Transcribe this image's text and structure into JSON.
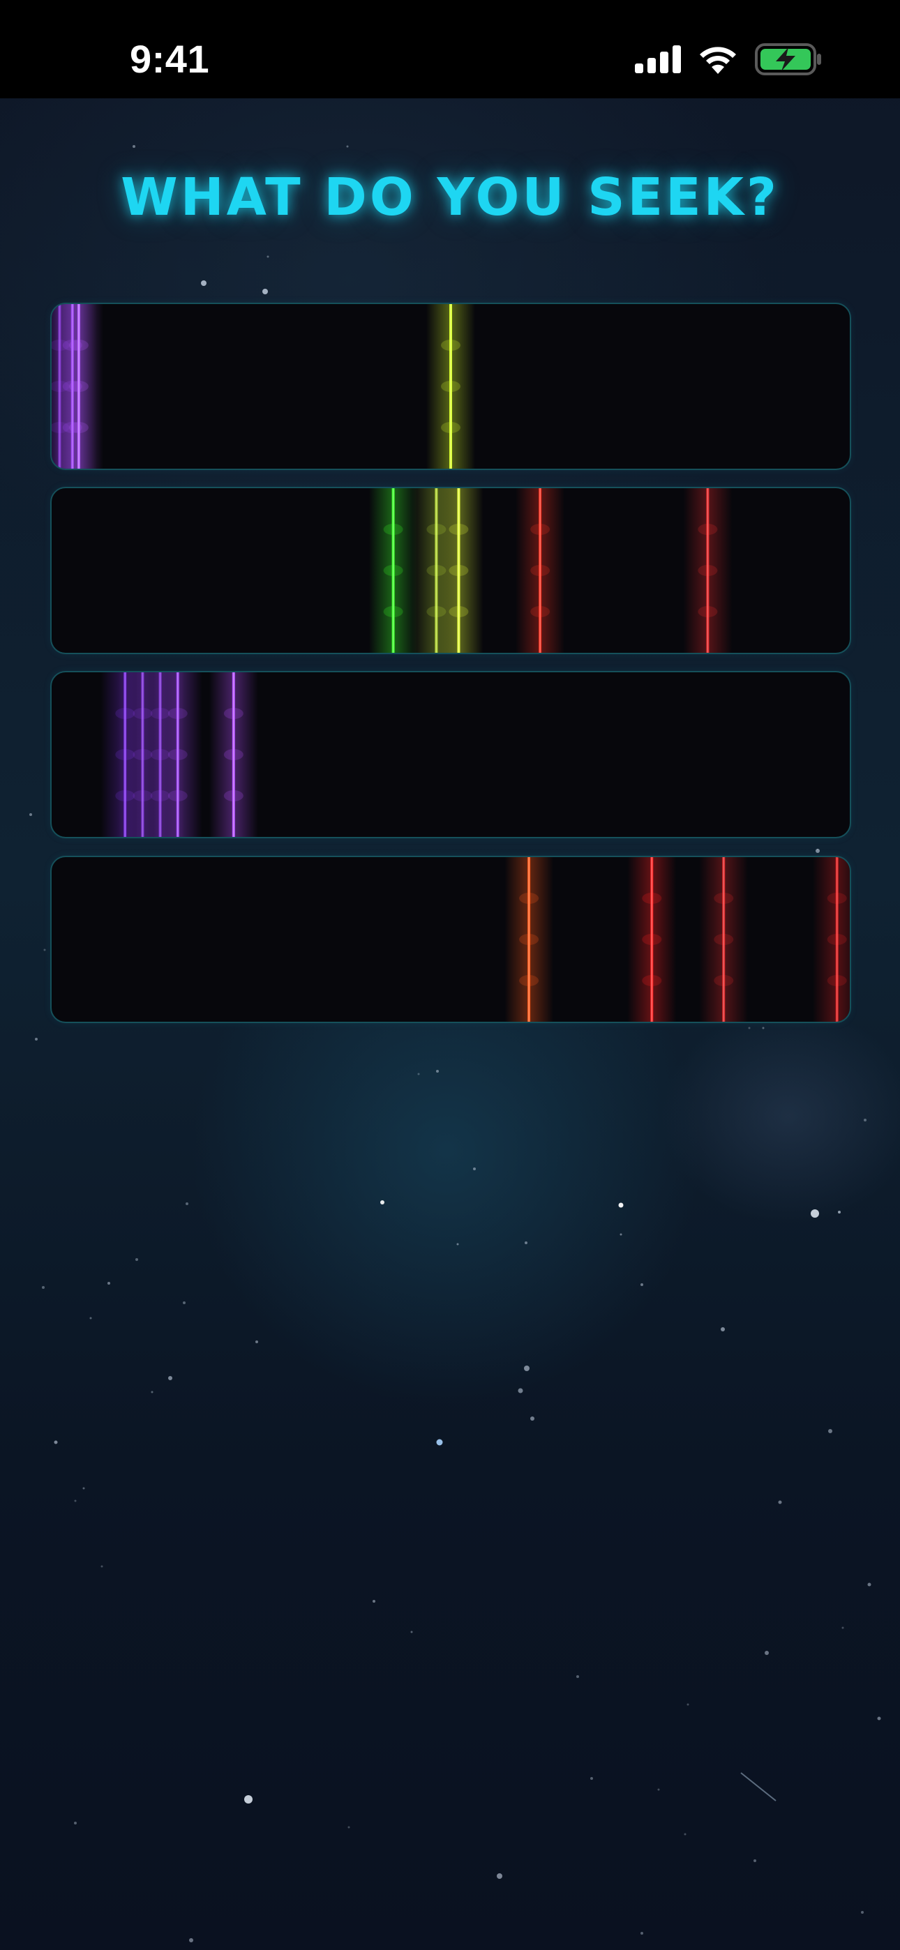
{
  "status_bar": {
    "time": "9:41",
    "icons": [
      "cellular-signal-icon",
      "wifi-icon",
      "battery-charging-icon"
    ],
    "battery_color": "#34c759"
  },
  "title": "WHAT DO YOU SEEK?",
  "accent_color": "#1ed6f2",
  "spectra": [
    {
      "id": "spectrum-1",
      "lines": [
        {
          "pos": 0.01,
          "color": "#9b3dff",
          "intensity": 0.6
        },
        {
          "pos": 0.026,
          "color": "#a247ff",
          "intensity": 0.9
        },
        {
          "pos": 0.034,
          "color": "#b45cff",
          "intensity": 1.0
        },
        {
          "pos": 0.5,
          "color": "#d8ff2a",
          "intensity": 1.0
        }
      ]
    },
    {
      "id": "spectrum-2",
      "lines": [
        {
          "pos": 0.428,
          "color": "#3cff2a",
          "intensity": 1.0
        },
        {
          "pos": 0.482,
          "color": "#c8f03a",
          "intensity": 0.8
        },
        {
          "pos": 0.51,
          "color": "#e6ff3a",
          "intensity": 1.0
        },
        {
          "pos": 0.612,
          "color": "#ff3322",
          "intensity": 0.95
        },
        {
          "pos": 0.822,
          "color": "#ff3030",
          "intensity": 0.85
        }
      ]
    },
    {
      "id": "spectrum-3",
      "lines": [
        {
          "pos": 0.092,
          "color": "#8a36ff",
          "intensity": 0.8
        },
        {
          "pos": 0.114,
          "color": "#9a40ff",
          "intensity": 0.7
        },
        {
          "pos": 0.136,
          "color": "#9a40ff",
          "intensity": 0.7
        },
        {
          "pos": 0.158,
          "color": "#a64aff",
          "intensity": 0.9
        },
        {
          "pos": 0.228,
          "color": "#b550ff",
          "intensity": 1.0
        }
      ]
    },
    {
      "id": "spectrum-4",
      "lines": [
        {
          "pos": 0.598,
          "color": "#ff5a1a",
          "intensity": 1.0
        },
        {
          "pos": 0.752,
          "color": "#ff2222",
          "intensity": 1.0
        },
        {
          "pos": 0.842,
          "color": "#ff3030",
          "intensity": 0.8
        },
        {
          "pos": 0.984,
          "color": "#ff2626",
          "intensity": 0.8
        }
      ]
    }
  ]
}
